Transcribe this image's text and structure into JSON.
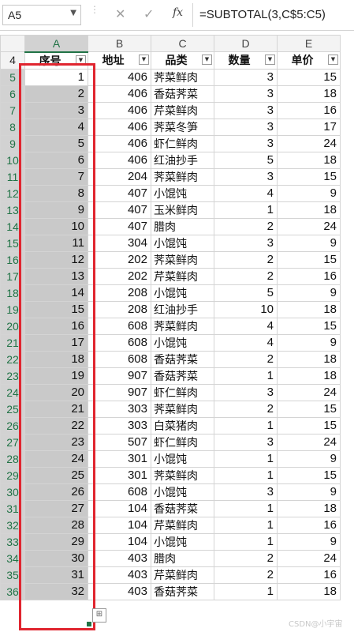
{
  "formula_bar": {
    "name_box": "A5",
    "cancel_icon": "✕",
    "enter_icon": "✓",
    "fx_label": "fx",
    "formula": "=SUBTOTAL(3,C$5:C5)"
  },
  "columns": [
    "A",
    "B",
    "C",
    "D",
    "E"
  ],
  "header_row": {
    "row_number": "4",
    "labels": [
      "序号",
      "地址",
      "品类",
      "数量",
      "单价"
    ]
  },
  "rows": [
    {
      "r": "5",
      "seq": "1",
      "addr": "406",
      "item": "荠菜鲜肉",
      "qty": "3",
      "price": "15"
    },
    {
      "r": "6",
      "seq": "2",
      "addr": "406",
      "item": "香菇荠菜",
      "qty": "3",
      "price": "18"
    },
    {
      "r": "7",
      "seq": "3",
      "addr": "406",
      "item": "芹菜鲜肉",
      "qty": "3",
      "price": "16"
    },
    {
      "r": "8",
      "seq": "4",
      "addr": "406",
      "item": "荠菜冬笋",
      "qty": "3",
      "price": "17"
    },
    {
      "r": "9",
      "seq": "5",
      "addr": "406",
      "item": "虾仁鲜肉",
      "qty": "3",
      "price": "24"
    },
    {
      "r": "10",
      "seq": "6",
      "addr": "406",
      "item": "红油抄手",
      "qty": "5",
      "price": "18"
    },
    {
      "r": "11",
      "seq": "7",
      "addr": "204",
      "item": "荠菜鲜肉",
      "qty": "3",
      "price": "15"
    },
    {
      "r": "12",
      "seq": "8",
      "addr": "407",
      "item": "小馄饨",
      "qty": "4",
      "price": "9"
    },
    {
      "r": "13",
      "seq": "9",
      "addr": "407",
      "item": "玉米鲜肉",
      "qty": "1",
      "price": "18"
    },
    {
      "r": "14",
      "seq": "10",
      "addr": "407",
      "item": "腊肉",
      "qty": "2",
      "price": "24"
    },
    {
      "r": "15",
      "seq": "11",
      "addr": "304",
      "item": "小馄饨",
      "qty": "3",
      "price": "9"
    },
    {
      "r": "16",
      "seq": "12",
      "addr": "202",
      "item": "荠菜鲜肉",
      "qty": "2",
      "price": "15"
    },
    {
      "r": "17",
      "seq": "13",
      "addr": "202",
      "item": "芹菜鲜肉",
      "qty": "2",
      "price": "16"
    },
    {
      "r": "18",
      "seq": "14",
      "addr": "208",
      "item": "小馄饨",
      "qty": "5",
      "price": "9"
    },
    {
      "r": "19",
      "seq": "15",
      "addr": "208",
      "item": "红油抄手",
      "qty": "10",
      "price": "18"
    },
    {
      "r": "20",
      "seq": "16",
      "addr": "608",
      "item": "荠菜鲜肉",
      "qty": "4",
      "price": "15"
    },
    {
      "r": "21",
      "seq": "17",
      "addr": "608",
      "item": "小馄饨",
      "qty": "4",
      "price": "9"
    },
    {
      "r": "22",
      "seq": "18",
      "addr": "608",
      "item": "香菇荠菜",
      "qty": "2",
      "price": "18"
    },
    {
      "r": "23",
      "seq": "19",
      "addr": "907",
      "item": "香菇荠菜",
      "qty": "1",
      "price": "18"
    },
    {
      "r": "24",
      "seq": "20",
      "addr": "907",
      "item": "虾仁鲜肉",
      "qty": "3",
      "price": "24"
    },
    {
      "r": "25",
      "seq": "21",
      "addr": "303",
      "item": "荠菜鲜肉",
      "qty": "2",
      "price": "15"
    },
    {
      "r": "26",
      "seq": "22",
      "addr": "303",
      "item": "白菜猪肉",
      "qty": "1",
      "price": "15"
    },
    {
      "r": "27",
      "seq": "23",
      "addr": "507",
      "item": "虾仁鲜肉",
      "qty": "3",
      "price": "24"
    },
    {
      "r": "28",
      "seq": "24",
      "addr": "301",
      "item": "小馄饨",
      "qty": "1",
      "price": "9"
    },
    {
      "r": "29",
      "seq": "25",
      "addr": "301",
      "item": "荠菜鲜肉",
      "qty": "1",
      "price": "15"
    },
    {
      "r": "30",
      "seq": "26",
      "addr": "608",
      "item": "小馄饨",
      "qty": "3",
      "price": "9"
    },
    {
      "r": "31",
      "seq": "27",
      "addr": "104",
      "item": "香菇荠菜",
      "qty": "1",
      "price": "18"
    },
    {
      "r": "32",
      "seq": "28",
      "addr": "104",
      "item": "芹菜鲜肉",
      "qty": "1",
      "price": "16"
    },
    {
      "r": "33",
      "seq": "29",
      "addr": "104",
      "item": "小馄饨",
      "qty": "1",
      "price": "9"
    },
    {
      "r": "34",
      "seq": "30",
      "addr": "403",
      "item": "腊肉",
      "qty": "2",
      "price": "24"
    },
    {
      "r": "35",
      "seq": "31",
      "addr": "403",
      "item": "芹菜鲜肉",
      "qty": "2",
      "price": "16"
    },
    {
      "r": "36",
      "seq": "32",
      "addr": "403",
      "item": "香菇荠菜",
      "qty": "1",
      "price": "18"
    }
  ],
  "watermark": "CSDN@小宇宙",
  "colors": {
    "selection_fill": "#c9c9c9",
    "highlight_border": "#e0252f",
    "excel_green": "#217346"
  }
}
